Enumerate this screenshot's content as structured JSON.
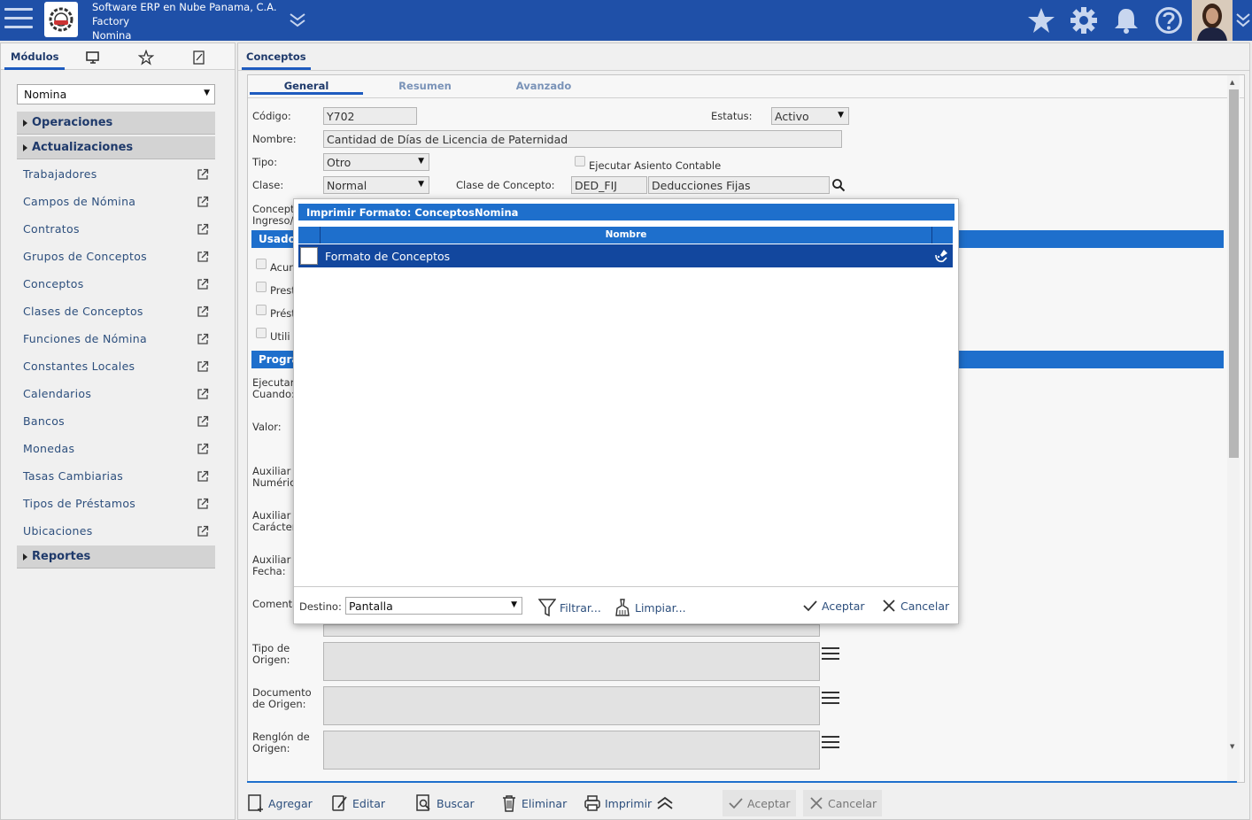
{
  "header": {
    "company": "Software ERP en Nube Panama, C.A.",
    "branch": "Factory",
    "module": "Nomina"
  },
  "sidebar": {
    "tab_modules": "Módulos",
    "module_select": "Nomina",
    "sections": {
      "operaciones": "Operaciones",
      "actualizaciones": "Actualizaciones",
      "reportes": "Reportes"
    },
    "items": [
      "Trabajadores",
      "Campos de Nómina",
      "Contratos",
      "Grupos de Conceptos",
      "Conceptos",
      "Clases de Conceptos",
      "Funciones de Nómina",
      "Constantes Locales",
      "Calendarios",
      "Bancos",
      "Monedas",
      "Tasas Cambiarias",
      "Tipos de Préstamos",
      "Ubicaciones"
    ]
  },
  "main": {
    "tab": "Conceptos",
    "subtabs": [
      "General",
      "Resumen",
      "Avanzado"
    ],
    "form": {
      "codigo_label": "Código:",
      "codigo_value": "Y702",
      "estatus_label": "Estatus:",
      "estatus_value": "Activo",
      "nombre_label": "Nombre:",
      "nombre_value": "Cantidad de Días de Licencia de Paternidad",
      "tipo_label": "Tipo:",
      "tipo_value": "Otro",
      "asiento_label": "Ejecutar Asiento Contable",
      "clase_label": "Clase:",
      "clase_value": "Normal",
      "clase_concepto_label": "Clase de Concepto:",
      "clase_concepto_code": "DED_FIJ",
      "clase_concepto_desc": "Deducciones Fijas",
      "concepto_ingreso_label": "Concept\nIngreso/",
      "usado_bar": "Usado",
      "check_labels": [
        "Acum",
        "Prest",
        "Prést",
        "Utili"
      ],
      "prog_bar": "Progra",
      "ejecutar_label": "Ejecutar\nCuando:",
      "valor_label": "Valor:",
      "aux_num_label": "Auxiliar\nNuméric",
      "aux_car_label": "Auxiliar\nCarácter",
      "aux_fecha_label": "Auxiliar\nFecha:",
      "comentario_label": "Comenta",
      "tipo_origen_label": "Tipo de\nOrigen:",
      "doc_origen_label": "Documento\nde Origen:",
      "renglon_origen_label": "Renglón de\nOrigen:"
    },
    "toolbar": {
      "agregar": "Agregar",
      "editar": "Editar",
      "buscar": "Buscar",
      "eliminar": "Eliminar",
      "imprimir": "Imprimir",
      "aceptar": "Aceptar",
      "cancelar": "Cancelar"
    }
  },
  "modal": {
    "title": "Imprimir Formato: ConceptosNomina",
    "column_header": "Nombre",
    "rows": [
      "Formato de Conceptos"
    ],
    "destino_label": "Destino:",
    "destino_value": "Pantalla",
    "filtrar": "Filtrar...",
    "limpiar": "Limpiar...",
    "aceptar": "Aceptar",
    "cancelar": "Cancelar"
  },
  "colors": {
    "header_bg": "#1f50a8",
    "accent": "#1e6fcc",
    "selected_row": "#12479e"
  }
}
